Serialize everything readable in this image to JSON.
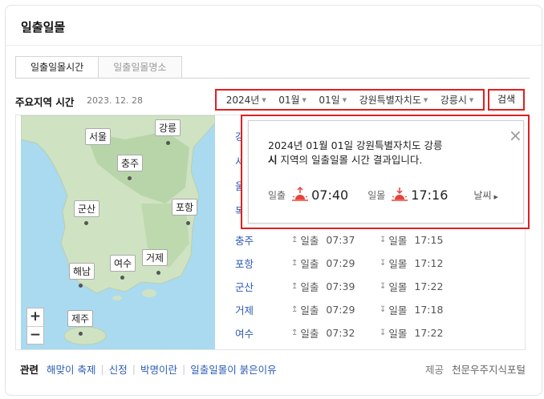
{
  "card": {
    "title": "일출일몰"
  },
  "tabs": [
    {
      "label": "일출일몰시간",
      "active": true
    },
    {
      "label": "일출일몰명소",
      "active": false
    }
  ],
  "major": {
    "title": "주요지역 시간",
    "date": "2023. 12. 28"
  },
  "filters": {
    "year": "2024년",
    "month": "01월",
    "day": "01일",
    "province": "강원특별자치도",
    "city": "강릉시"
  },
  "search_label": "검색",
  "map": {
    "cities": [
      "서울",
      "강릉",
      "충주",
      "군산",
      "포항",
      "해남",
      "여수",
      "거제",
      "제주"
    ],
    "zoom_in": "+",
    "zoom_out": "−"
  },
  "hidden_rows": [
    "강",
    "서",
    "울",
    "목"
  ],
  "rows": [
    {
      "city": "충주",
      "rise_label": "일출",
      "rise": "07:37",
      "set_label": "일몰",
      "set": "17:15"
    },
    {
      "city": "포항",
      "rise_label": "일출",
      "rise": "07:29",
      "set_label": "일몰",
      "set": "17:12"
    },
    {
      "city": "군산",
      "rise_label": "일출",
      "rise": "07:39",
      "set_label": "일몰",
      "set": "17:22"
    },
    {
      "city": "거제",
      "rise_label": "일출",
      "rise": "07:29",
      "set_label": "일몰",
      "set": "17:18"
    },
    {
      "city": "여수",
      "rise_label": "일출",
      "rise": "07:32",
      "set_label": "일몰",
      "set": "17:22"
    }
  ],
  "popup": {
    "line1": "2024년 01월 01일 강원특별자치도 강릉",
    "line2_strong": "시",
    "line2_rest": " 지역의 일출일몰 시간 결과입니다.",
    "rise_label": "일출",
    "rise_time": "07:40",
    "set_label": "일몰",
    "set_time": "17:16",
    "weather": "날씨",
    "close": "×"
  },
  "footer": {
    "related_title": "관련",
    "links": [
      "해맞이 축제",
      "신정",
      "박명이란",
      "일출일몰이 붉은이유"
    ],
    "provider_label": "제공",
    "provider": "천문우주지식포털"
  },
  "colors": {
    "accent_red": "#e02020",
    "link_blue": "#2a5bb5",
    "sun_red": "#e8433a"
  }
}
